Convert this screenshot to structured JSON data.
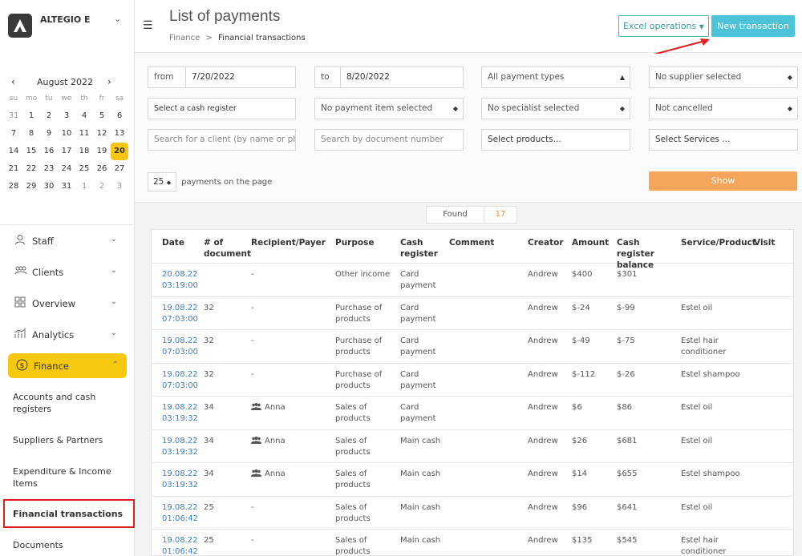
{
  "brand": {
    "name": "ALTEGIO E"
  },
  "calendar": {
    "month_label": "August 2022",
    "dow": [
      "su",
      "mo",
      "tu",
      "we",
      "th",
      "fr",
      "sa"
    ],
    "weeks": [
      [
        "31",
        "1",
        "2",
        "3",
        "4",
        "5",
        "6"
      ],
      [
        "7",
        "8",
        "9",
        "10",
        "11",
        "12",
        "13"
      ],
      [
        "14",
        "15",
        "16",
        "17",
        "18",
        "19",
        "20"
      ],
      [
        "21",
        "22",
        "23",
        "24",
        "25",
        "26",
        "27"
      ],
      [
        "28",
        "29",
        "30",
        "31",
        "1",
        "2",
        "3"
      ]
    ],
    "selected_day": "20"
  },
  "nav": {
    "staff": "Staff",
    "clients": "Clients",
    "overview": "Overview",
    "analytics": "Analytics",
    "finance": "Finance",
    "sub": {
      "accounts": "Accounts and cash registers",
      "suppliers": "Suppliers & Partners",
      "expenditure": "Expenditure & Income Items",
      "financial_transactions": "Financial transactions",
      "documents": "Documents"
    }
  },
  "header": {
    "title": "List of payments",
    "breadcrumb_root": "Finance",
    "breadcrumb_sep": ">",
    "breadcrumb_current": "Financial transactions",
    "excel_label": "Excel operations",
    "new_transaction_label": "New transaction"
  },
  "filters": {
    "from_label": "from",
    "from_value": "7/20/2022",
    "to_label": "to",
    "to_value": "8/20/2022",
    "payment_types": "All payment types",
    "supplier": "No supplier selected",
    "cash_register": "Select a cash register",
    "payment_item": "No payment item selected",
    "specialist": "No specialist selected",
    "cancelled": "Not cancelled",
    "client_search_placeholder": "Search for a client (by name or ph",
    "document_search_placeholder": "Search by document number",
    "products": "Select products...",
    "services": "Select Services ...",
    "per_page_value": "25",
    "per_page_label": "payments on the page",
    "show_label": "Show"
  },
  "found": {
    "label": "Found",
    "count": "17"
  },
  "table": {
    "headers": {
      "date": "Date",
      "doc": "# of document",
      "recipient": "Recipient/Payer",
      "purpose": "Purpose",
      "cash": "Cash register",
      "comment": "Comment",
      "creator": "Creator",
      "amount": "Amount",
      "balance": "Cash register balance",
      "service": "Service/Product",
      "visit": "Visit"
    },
    "rows": [
      {
        "date": "20.08.22 03:19:00",
        "doc": "",
        "recipient": "-",
        "purpose": "Other income",
        "cash": "Card payment",
        "creator": "Andrew",
        "amount": "$400",
        "balance": "$301",
        "service": ""
      },
      {
        "date": "19.08.22 07:03:00",
        "doc": "32",
        "recipient": "-",
        "purpose": "Purchase of products",
        "cash": "Card payment",
        "creator": "Andrew",
        "amount": "$-24",
        "balance": "$-99",
        "service": "Estel oil"
      },
      {
        "date": "19.08.22 07:03:00",
        "doc": "32",
        "recipient": "-",
        "purpose": "Purchase of products",
        "cash": "Card payment",
        "creator": "Andrew",
        "amount": "$-49",
        "balance": "$-75",
        "service": "Estel hair conditioner"
      },
      {
        "date": "19.08.22 07:03:00",
        "doc": "32",
        "recipient": "-",
        "purpose": "Purchase of products",
        "cash": "Card payment",
        "creator": "Andrew",
        "amount": "$-112",
        "balance": "$-26",
        "service": "Estel shampoo"
      },
      {
        "date": "19.08.22 03:19:32",
        "doc": "34",
        "recipient": "Anna",
        "purpose": "Sales of products",
        "cash": "Card payment",
        "creator": "Andrew",
        "amount": "$6",
        "balance": "$86",
        "service": "Estel oil"
      },
      {
        "date": "19.08.22 03:19:32",
        "doc": "34",
        "recipient": "Anna",
        "purpose": "Sales of products",
        "cash": "Main cash",
        "creator": "Andrew",
        "amount": "$26",
        "balance": "$681",
        "service": "Estel oil"
      },
      {
        "date": "19.08.22 03:19:32",
        "doc": "34",
        "recipient": "Anna",
        "purpose": "Sales of products",
        "cash": "Main cash",
        "creator": "Andrew",
        "amount": "$14",
        "balance": "$655",
        "service": "Estel shampoo"
      },
      {
        "date": "19.08.22 01:06:42",
        "doc": "25",
        "recipient": "-",
        "purpose": "Sales of products",
        "cash": "Main cash",
        "creator": "Andrew",
        "amount": "$96",
        "balance": "$641",
        "service": "Estel oil"
      },
      {
        "date": "19.08.22 01:06:42",
        "doc": "25",
        "recipient": "-",
        "purpose": "Sales of products",
        "cash": "Main cash",
        "creator": "Andrew",
        "amount": "$135",
        "balance": "$545",
        "service": "Estel hair conditioner"
      }
    ]
  },
  "colors": {
    "accent_yellow": "#f6c90e",
    "teal": "#4cc3d9",
    "orange": "#f4a55a",
    "link_blue": "#3a7cc4",
    "annotation_red": "#e02020"
  }
}
